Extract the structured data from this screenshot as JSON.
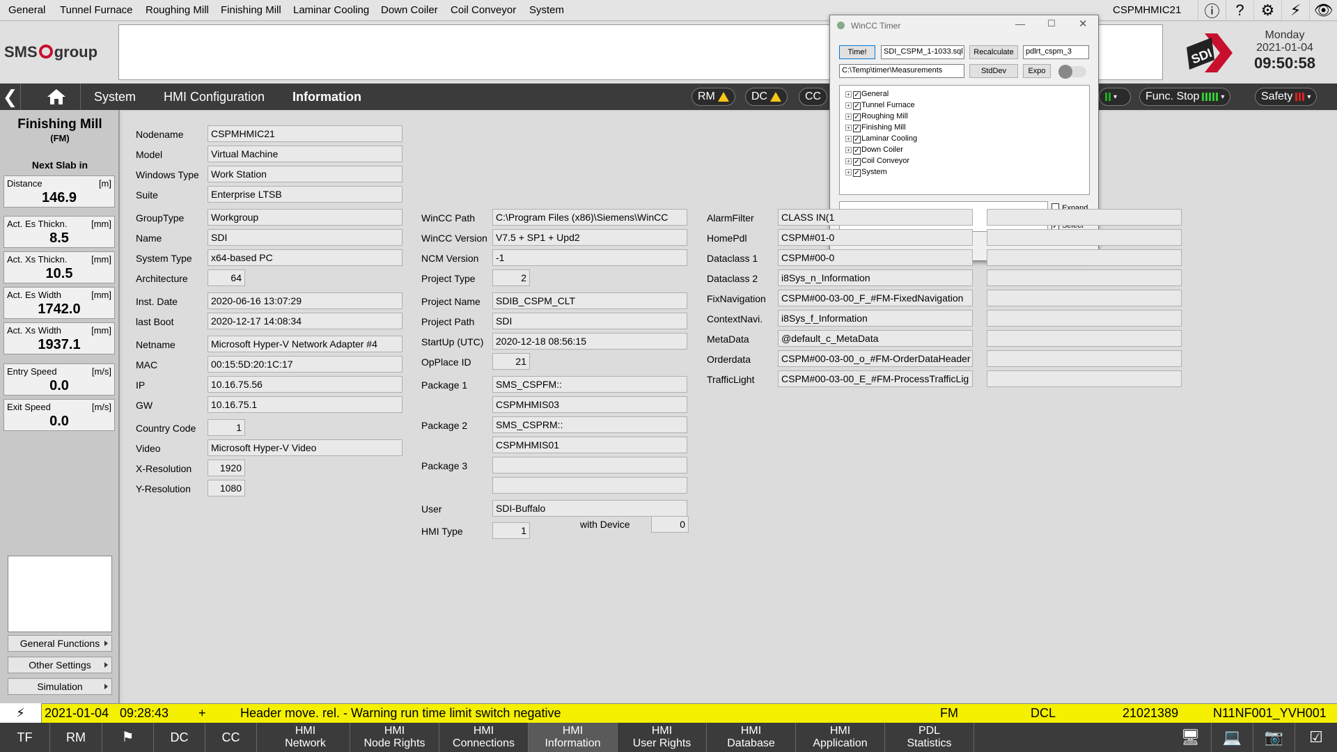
{
  "menu": {
    "items": [
      "General",
      "Tunnel Furnace",
      "Roughing Mill",
      "Finishing Mill",
      "Laminar Cooling",
      "Down Coiler",
      "Coil Conveyor",
      "System"
    ],
    "station": "CSPMHMIC21",
    "icons": [
      "info-icon",
      "help-icon",
      "gear-icon",
      "lightning-icon",
      "eye-icon"
    ]
  },
  "brand": {
    "logo_text": "SMS",
    "logo_text2": "group",
    "day": "Monday",
    "date": "2021-01-04",
    "time": "09:50:58"
  },
  "nav": {
    "crumbs": [
      "System",
      "HMI Configuration",
      "Information"
    ],
    "pills": [
      "RM",
      "DC",
      "CC"
    ],
    "func_stop": "Func. Stop",
    "safety": "Safety"
  },
  "left": {
    "title": "Finishing Mill",
    "subtitle": "(FM)",
    "section": "Next Slab in",
    "boxes": [
      {
        "label": "Distance",
        "unit": "[m]",
        "value": "146.9"
      },
      {
        "label": "Act. Es Thickn.",
        "unit": "[mm]",
        "value": "8.5"
      },
      {
        "label": "Act. Xs Thickn.",
        "unit": "[mm]",
        "value": "10.5"
      },
      {
        "label": "Act. Es Width",
        "unit": "[mm]",
        "value": "1742.0"
      },
      {
        "label": "Act. Xs Width",
        "unit": "[mm]",
        "value": "1937.1"
      },
      {
        "label": "Entry Speed",
        "unit": "[m/s]",
        "value": "0.0"
      },
      {
        "label": "Exit Speed",
        "unit": "[m/s]",
        "value": "0.0"
      }
    ],
    "buttons": [
      "General Functions",
      "Other Settings",
      "Simulation"
    ]
  },
  "info": {
    "col1": [
      {
        "label": "Nodename",
        "value": "CSPMHMIC21"
      },
      {
        "label": "Model",
        "value": "Virtual Machine"
      },
      {
        "label": "Windows Type",
        "value": "Work Station"
      },
      {
        "label": "Suite",
        "value": "Enterprise LTSB"
      },
      {
        "label": "GroupType",
        "value": "Workgroup"
      },
      {
        "label": "Name",
        "value": "SDI"
      },
      {
        "label": "System Type",
        "value": "x64-based PC"
      },
      {
        "label": "Architecture",
        "value": "64"
      },
      {
        "label": "Inst. Date",
        "value": "2020-06-16 13:07:29"
      },
      {
        "label": "last Boot",
        "value": "2020-12-17 14:08:34"
      },
      {
        "label": "Netname",
        "value": "Microsoft Hyper-V Network Adapter #4"
      },
      {
        "label": "MAC",
        "value": "00:15:5D:20:1C:17"
      },
      {
        "label": "IP",
        "value": "10.16.75.56"
      },
      {
        "label": "GW",
        "value": "10.16.75.1"
      },
      {
        "label": "Country Code",
        "value": "1"
      },
      {
        "label": "Video",
        "value": "Microsoft Hyper-V Video"
      },
      {
        "label": "X-Resolution",
        "value": "1920"
      },
      {
        "label": "Y-Resolution",
        "value": "1080"
      }
    ],
    "col2": [
      {
        "label": "WinCC Path",
        "value": "C:\\Program Files (x86)\\Siemens\\WinCC"
      },
      {
        "label": "WinCC Version",
        "value": "V7.5 + SP1 + Upd2"
      },
      {
        "label": "NCM Version",
        "value": "-1"
      },
      {
        "label": "Project Type",
        "value": "2"
      },
      {
        "label": "Project Name",
        "value": "SDIB_CSPM_CLT"
      },
      {
        "label": "Project Path",
        "value": "SDI"
      },
      {
        "label": "StartUp (UTC)",
        "value": "2020-12-18 08:56:15"
      },
      {
        "label": "OpPlace ID",
        "value": "21"
      },
      {
        "label": "Package 1",
        "value": "SMS_CSPFM::"
      },
      {
        "label": "",
        "value": "CSPMHMIS03"
      },
      {
        "label": "Package 2",
        "value": "SMS_CSPRM::"
      },
      {
        "label": "",
        "value": "CSPMHMIS01"
      },
      {
        "label": "Package 3",
        "value": ""
      },
      {
        "label": "",
        "value": ""
      },
      {
        "label": "User",
        "value": "SDI-Buffalo"
      },
      {
        "label": "HMI Type",
        "value": "1"
      }
    ],
    "with_device_label": "with Device",
    "with_device_value": "0",
    "col3": [
      {
        "label": "AlarmFilter",
        "value": "CLASS IN(1"
      },
      {
        "label": "HomePdl",
        "value": "CSPM#01-0"
      },
      {
        "label": "Dataclass 1",
        "value": "CSPM#00-0"
      },
      {
        "label": "Dataclass 2",
        "value": "i8Sys_n_Information"
      },
      {
        "label": "FixNavigation",
        "value": "CSPM#00-03-00_F_#FM-FixedNavigation"
      },
      {
        "label": "ContextNavi.",
        "value": "i8Sys_f_Information"
      },
      {
        "label": "MetaData",
        "value": "@default_c_MetaData"
      },
      {
        "label": "Orderdata",
        "value": "CSPM#00-03-00_o_#FM-OrderDataHeader"
      },
      {
        "label": "TrafficLight",
        "value": "CSPM#00-03-00_E_#FM-ProcessTrafficLig"
      }
    ]
  },
  "status": {
    "date": "2021-01-04",
    "time": "09:28:43",
    "sign": "+",
    "message": "Header move. rel. - Warning run time limit switch negative",
    "area": "FM",
    "code": "DCL",
    "number": "21021389",
    "tag": "N11NF001_YVH001"
  },
  "bottom": {
    "left": [
      "TF",
      "RM",
      "",
      "DC",
      "CC"
    ],
    "tabs": [
      {
        "l1": "HMI",
        "l2": "Network"
      },
      {
        "l1": "HMI",
        "l2": "Node Rights"
      },
      {
        "l1": "HMI",
        "l2": "Connections"
      },
      {
        "l1": "HMI",
        "l2": "Information"
      },
      {
        "l1": "HMI",
        "l2": "User Rights"
      },
      {
        "l1": "HMI",
        "l2": "Database"
      },
      {
        "l1": "HMI",
        "l2": "Application"
      },
      {
        "l1": "PDL",
        "l2": "Statistics"
      }
    ]
  },
  "dialog": {
    "title": "WinCC Timer",
    "time_btn": "Time!",
    "sql_field": "SDI_CSPM_1-1033.sql",
    "recalc_btn": "Recalculate",
    "db_field": "pdlrt_cspm_3",
    "path_field": "C:\\Temp\\timer\\Measurements",
    "stddev_btn": "StdDev",
    "expo_btn": "Expo",
    "tree": [
      "General",
      "Tunnel Furnace",
      "Roughing Mill",
      "Finishing Mill",
      "Laminar Cooling",
      "Down Coiler",
      "Coil Conveyor",
      "System"
    ],
    "expand_label": "Expand",
    "expand_checked": false,
    "select_label": "Select",
    "select_checked": true
  },
  "colors": {
    "status_bg": "#f4f000",
    "navbar": "#3b3b3b",
    "brand_red": "#c8102e",
    "warn": "#f5c518"
  }
}
